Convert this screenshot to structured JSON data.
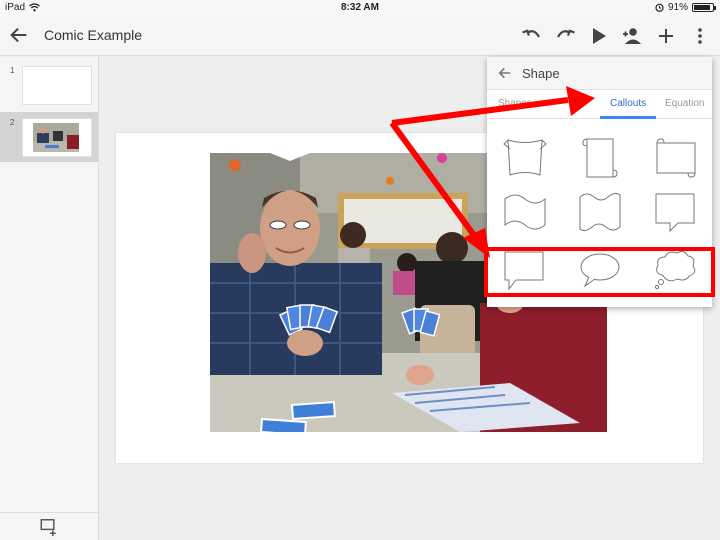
{
  "status_bar": {
    "carrier": "iPad",
    "time": "8:32 AM",
    "battery": "91%",
    "battery_level": 0.91
  },
  "toolbar": {
    "back_icon": "arrow-left-icon",
    "title": "Comic Example",
    "actions": [
      "undo-icon",
      "redo-icon",
      "play-icon",
      "add-person-icon",
      "plus-icon",
      "more-vert-icon"
    ]
  },
  "slides": [
    {
      "number": "1"
    },
    {
      "number": "2"
    }
  ],
  "shape_panel": {
    "title": "Shape",
    "tabs": [
      "Shapes",
      "Callouts",
      "Equation"
    ],
    "active_tab": "Callouts",
    "shapes": [
      "scroll-banner",
      "vertical-scroll",
      "horizontal-scroll",
      "wave",
      "double-wave",
      "rect-callout",
      "speech-callout",
      "oval-callout",
      "cloud-callout"
    ]
  },
  "colors": {
    "accent": "#4285f4",
    "annotation": "#ff0000"
  }
}
